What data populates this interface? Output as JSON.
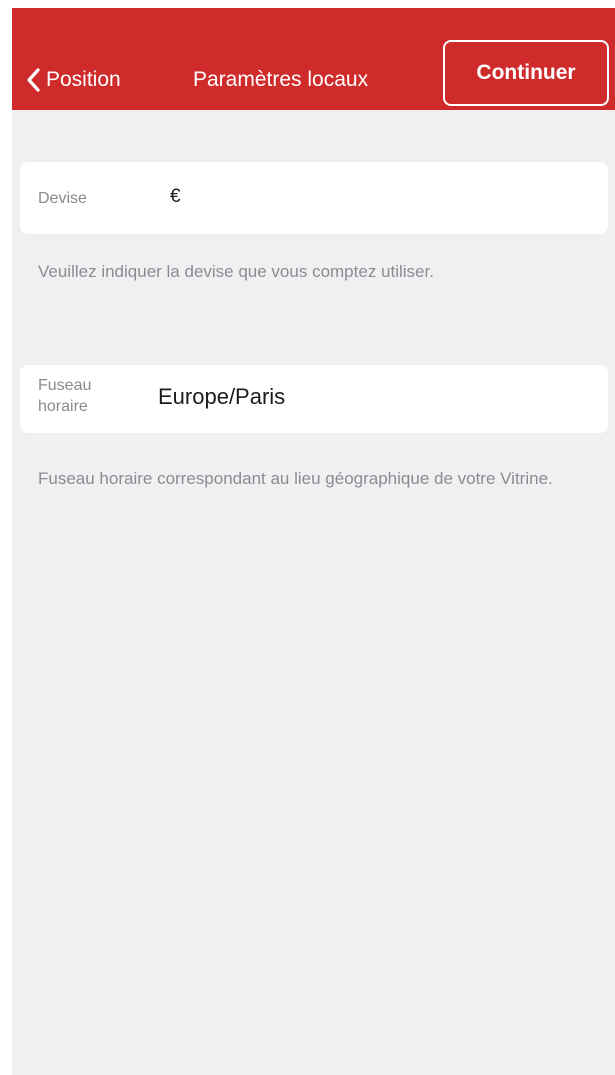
{
  "navbar": {
    "back_label": "Position",
    "title": "Paramètres locaux",
    "continue_label": "Continuer",
    "color": "#cf2b2b"
  },
  "currency": {
    "label": "Devise",
    "value": "€",
    "hint": "Veuillez indiquer la devise que vous comptez utiliser."
  },
  "timezone": {
    "label": "Fuseau horaire",
    "value": "Europe/Paris",
    "hint": "Fuseau horaire correspondant au lieu géographique de votre Vitrine."
  }
}
